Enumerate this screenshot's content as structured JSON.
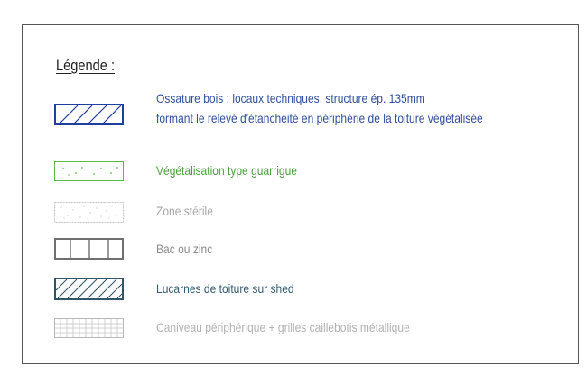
{
  "title": "Légende :",
  "items": [
    {
      "lines": [
        "Ossature bois : locaux techniques, structure ép. 135mm",
        "formant le relevé d'étanchéité en périphérie de la toiture végétalisée"
      ],
      "text_color": "#2f4fa2",
      "pattern": "diagonal-hatch-wide",
      "pattern_color": "#1f3f9c"
    },
    {
      "lines": [
        "Végétalisation type guarrigue"
      ],
      "text_color": "#4aa23c",
      "pattern": "dots",
      "pattern_color": "#5aba45"
    },
    {
      "lines": [
        "Zone stérile"
      ],
      "text_color": "#a8a8a8",
      "pattern": "speckle",
      "pattern_color": "#b4b4b4"
    },
    {
      "lines": [
        "Bac ou zinc"
      ],
      "text_color": "#8a8a8a",
      "pattern": "vertical-divisions",
      "pattern_color": "#6f6f6f"
    },
    {
      "lines": [
        "Lucarnes de toiture sur shed"
      ],
      "text_color": "#345d73",
      "pattern": "diagonal-hatch-dense",
      "pattern_color": "#2f5568"
    },
    {
      "lines": [
        "Caniveau périphérique + grilles caillebotis métallique"
      ],
      "text_color": "#b2b2b2",
      "pattern": "grid",
      "pattern_color": "#b8b8b8"
    }
  ]
}
